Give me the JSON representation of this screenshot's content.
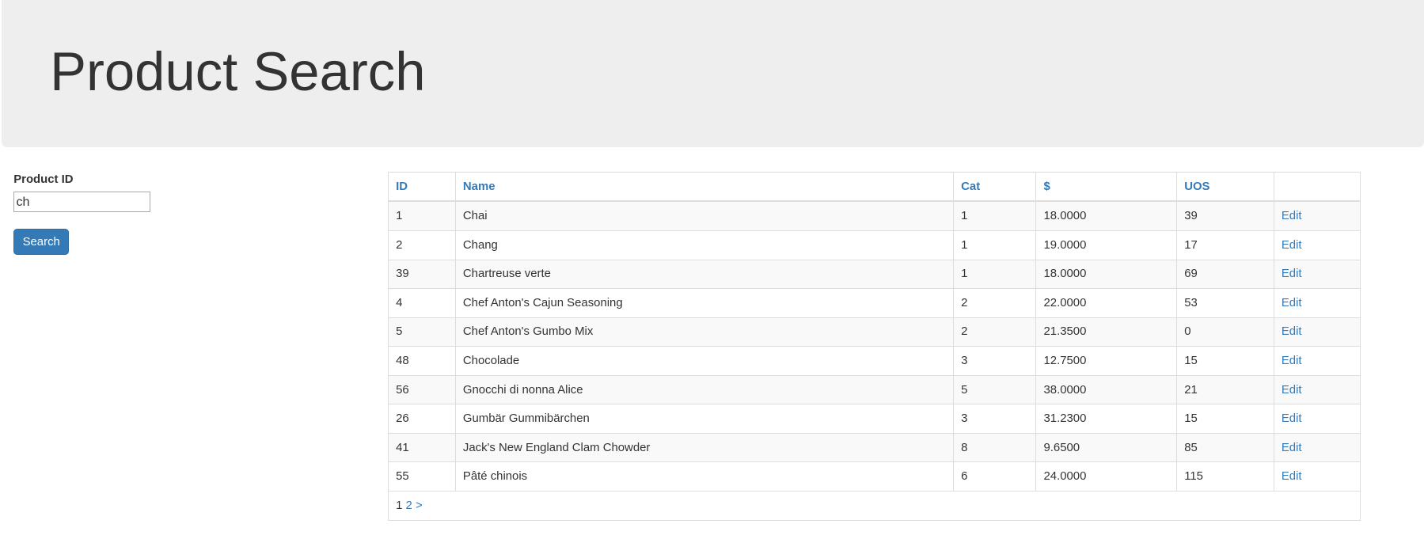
{
  "header": {
    "title": "Product Search"
  },
  "form": {
    "label": "Product ID",
    "value": "ch",
    "button": "Search"
  },
  "table": {
    "columns": [
      "ID",
      "Name",
      "Cat",
      "$",
      "UOS",
      ""
    ],
    "rows": [
      [
        "1",
        "Chai",
        "1",
        "18.0000",
        "39",
        "Edit"
      ],
      [
        "2",
        "Chang",
        "1",
        "19.0000",
        "17",
        "Edit"
      ],
      [
        "39",
        "Chartreuse verte",
        "1",
        "18.0000",
        "69",
        "Edit"
      ],
      [
        "4",
        "Chef Anton's Cajun Seasoning",
        "2",
        "22.0000",
        "53",
        "Edit"
      ],
      [
        "5",
        "Chef Anton's Gumbo Mix",
        "2",
        "21.3500",
        "0",
        "Edit"
      ],
      [
        "48",
        "Chocolade",
        "3",
        "12.7500",
        "15",
        "Edit"
      ],
      [
        "56",
        "Gnocchi di nonna Alice",
        "5",
        "38.0000",
        "21",
        "Edit"
      ],
      [
        "26",
        "Gumbär Gummibärchen",
        "3",
        "31.2300",
        "15",
        "Edit"
      ],
      [
        "41",
        "Jack's New England Clam Chowder",
        "8",
        "9.6500",
        "85",
        "Edit"
      ],
      [
        "55",
        "Pâté chinois",
        "6",
        "24.0000",
        "115",
        "Edit"
      ]
    ],
    "pager": {
      "current": "1",
      "next_page": "2",
      "next": ">"
    }
  }
}
